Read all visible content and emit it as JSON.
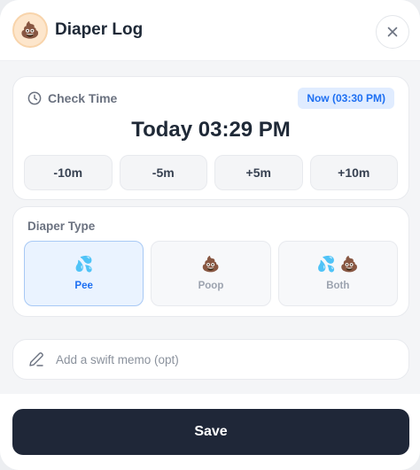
{
  "header": {
    "avatar_emoji": "💩",
    "title": "Diaper Log",
    "close_icon": "close-icon"
  },
  "check_time": {
    "label": "Check Time",
    "icon": "clock-icon",
    "now_badge": "Now (03:30 PM)",
    "time_display": "Today 03:29 PM",
    "adjust_buttons": [
      {
        "label": "-10m"
      },
      {
        "label": "-5m"
      },
      {
        "label": "+5m"
      },
      {
        "label": "+10m"
      }
    ]
  },
  "diaper_type": {
    "label": "Diaper Type",
    "selected": "Pee",
    "options": [
      {
        "icon": "💦",
        "label": "Pee"
      },
      {
        "icon": "💩",
        "label": "Poop"
      },
      {
        "icon": "💦 💩",
        "label": "Both"
      }
    ]
  },
  "memo": {
    "icon": "pencil-icon",
    "placeholder": "Add a swift memo (opt)",
    "value": ""
  },
  "footer": {
    "save_label": "Save"
  },
  "colors": {
    "accent": "#1d6ff2",
    "accent_bg": "#e0ecff",
    "save_button": "#1f2738",
    "avatar_bg": "#fde6cc"
  }
}
